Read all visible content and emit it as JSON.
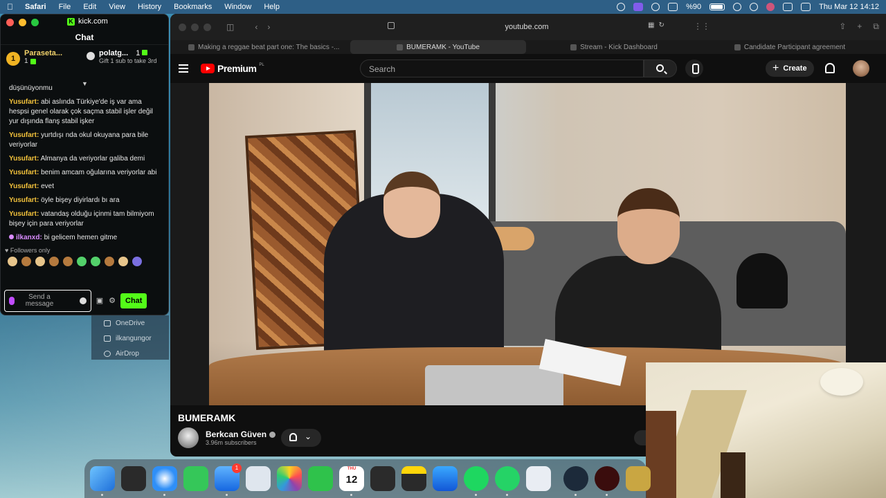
{
  "menubar": {
    "app": "Safari",
    "items": [
      "File",
      "Edit",
      "View",
      "History",
      "Bookmarks",
      "Window",
      "Help"
    ],
    "battery": "%90",
    "clock": "Thu Mar 12  14:12"
  },
  "kick": {
    "url": "kick.com",
    "chat_title": "Chat",
    "leaderboard": {
      "first": {
        "rank": "1",
        "name": "Paraseta...",
        "count": "1"
      },
      "second": {
        "name": "polatg...",
        "count": "1",
        "note": "Gift 1 sub to take 3rd"
      }
    },
    "messages": [
      {
        "user": "",
        "text": "düşünüyonmu"
      },
      {
        "user": "Yusufart:",
        "text": "abi aslında Türkiye'de iş var ama hespsi genel olarak çok saçma stabil işler değil yur dışında flanş stabil işker"
      },
      {
        "user": "Yusufart:",
        "text": "yurtdışı nda okul okuyana para bile veriyorlar"
      },
      {
        "user": "Yusufart:",
        "text": "Almanya da veriyorlar galiba demi"
      },
      {
        "user": "Yusufart:",
        "text": "benim amcam oğularına veriyorlar abi"
      },
      {
        "user": "Yusufart:",
        "text": "evet"
      },
      {
        "user": "Yusufart:",
        "text": "öyle bişey diyirlardı bı ara"
      },
      {
        "user": "Yusufart:",
        "text": "vatandaş olduğu içinmi tam bilmiyom bişey için para veriyorlar"
      },
      {
        "user": "ilkanxd:",
        "text": "bi gelicem hemen gitme"
      }
    ],
    "followers_only": "Followers only",
    "input_placeholder": "Send a message",
    "chat_button": "Chat"
  },
  "finder": {
    "items": [
      "OneDrive",
      "ilkangungor",
      "AirDrop"
    ]
  },
  "safari": {
    "url": "youtube.com",
    "tabs": [
      "Making a reggae beat part one: The basics -...",
      "BUMERAMK - YouTube",
      "Stream - Kick Dashboard",
      "Candidate Participant agreement"
    ]
  },
  "youtube": {
    "logo": "Premium",
    "logo_region": "PL",
    "search_placeholder": "Search",
    "create_label": "Create",
    "video_title": "BUMERAMK",
    "channel_name": "Berkcan Güven",
    "subscribers": "3.96m subscribers"
  },
  "dock": {
    "calendar_month": "THU",
    "calendar_day": "12",
    "mail_badge": "1"
  },
  "colors": {
    "kick_green": "#53fc18",
    "youtube_red": "#ff0000",
    "leader_gold": "#f0b323"
  }
}
